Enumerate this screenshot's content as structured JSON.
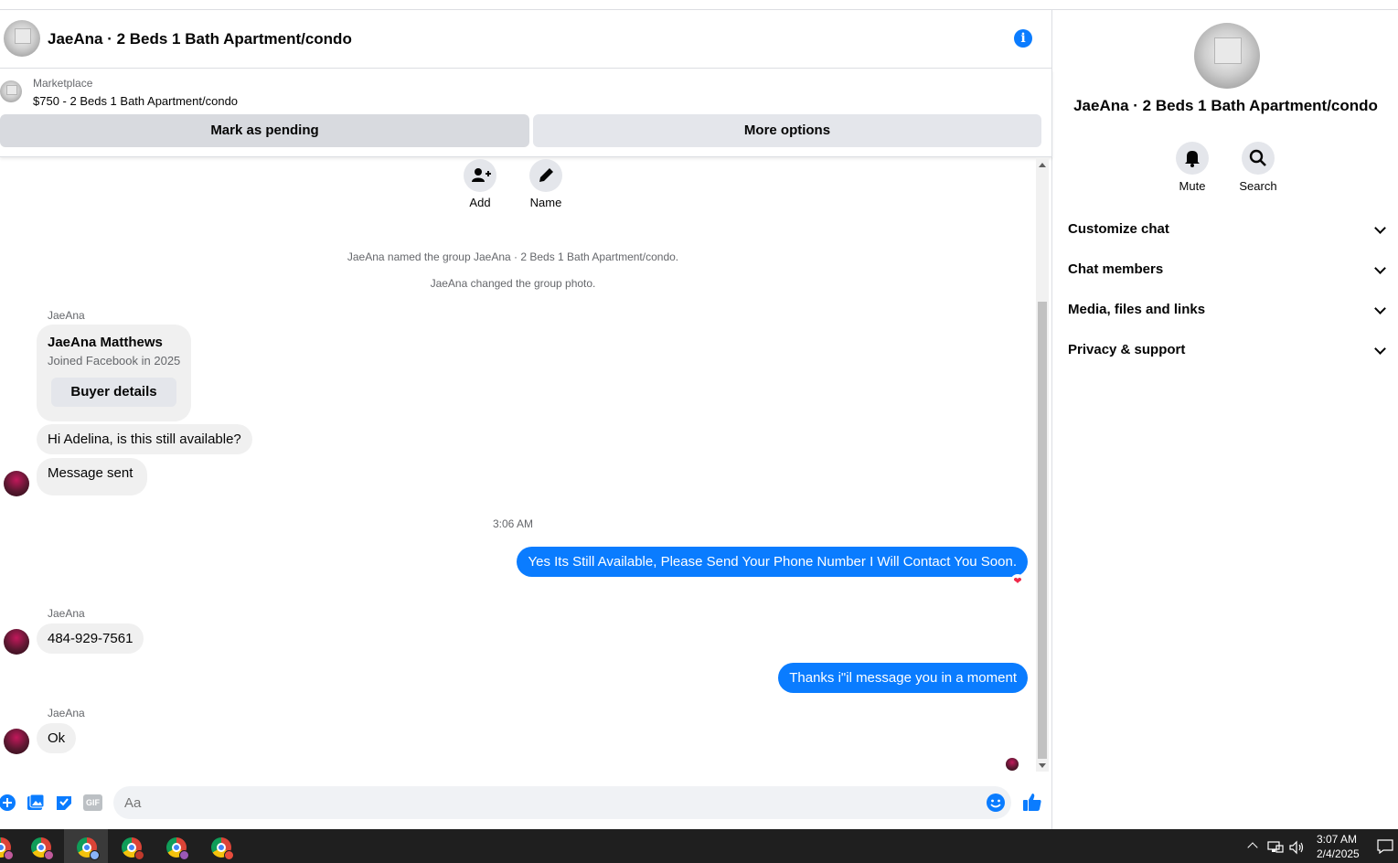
{
  "header": {
    "title": "JaeAna · 2 Beds 1 Bath Apartment/condo"
  },
  "listing": {
    "source": "Marketplace",
    "price_title": "$750 - 2 Beds 1 Bath Apartment/condo",
    "mark_pending_label": "Mark as pending",
    "more_options_label": "More options"
  },
  "actions": {
    "add_label": "Add",
    "name_label": "Name"
  },
  "messages": {
    "system_1": "JaeAna named the group JaeAna · 2 Beds 1 Bath Apartment/condo.",
    "system_2": "JaeAna changed the group photo.",
    "sender_1": "JaeAna",
    "profile_name": "JaeAna Matthews",
    "profile_joined": "Joined Facebook in 2025",
    "buyer_details_label": "Buyer details",
    "msg_1": "Hi Adelina, is this still available?",
    "msg_2": "Message sent",
    "timestamp": "3:06 AM",
    "out_1": "Yes Its Still Available, Please Send Your Phone Number I Will Contact You Soon.",
    "sender_2": "JaeAna",
    "msg_3": "484-929-7561",
    "out_2": "Thanks i\"il message you in a moment",
    "sender_3": "JaeAna",
    "msg_4": "Ok"
  },
  "composer": {
    "placeholder": "Aa",
    "gif_label": "GIF"
  },
  "sidebar": {
    "title": "JaeAna · 2 Beds 1 Bath Apartment/condo",
    "mute_label": "Mute",
    "search_label": "Search",
    "sections": [
      {
        "label": "Customize chat"
      },
      {
        "label": "Chat members"
      },
      {
        "label": "Media, files and links"
      },
      {
        "label": "Privacy & support"
      }
    ]
  },
  "taskbar": {
    "time": "3:07 AM",
    "date": "2/4/2025"
  },
  "colors": {
    "accent": "#0a7cff",
    "bubble_in": "#f0f0f0",
    "button_grey": "#e4e6eb"
  }
}
